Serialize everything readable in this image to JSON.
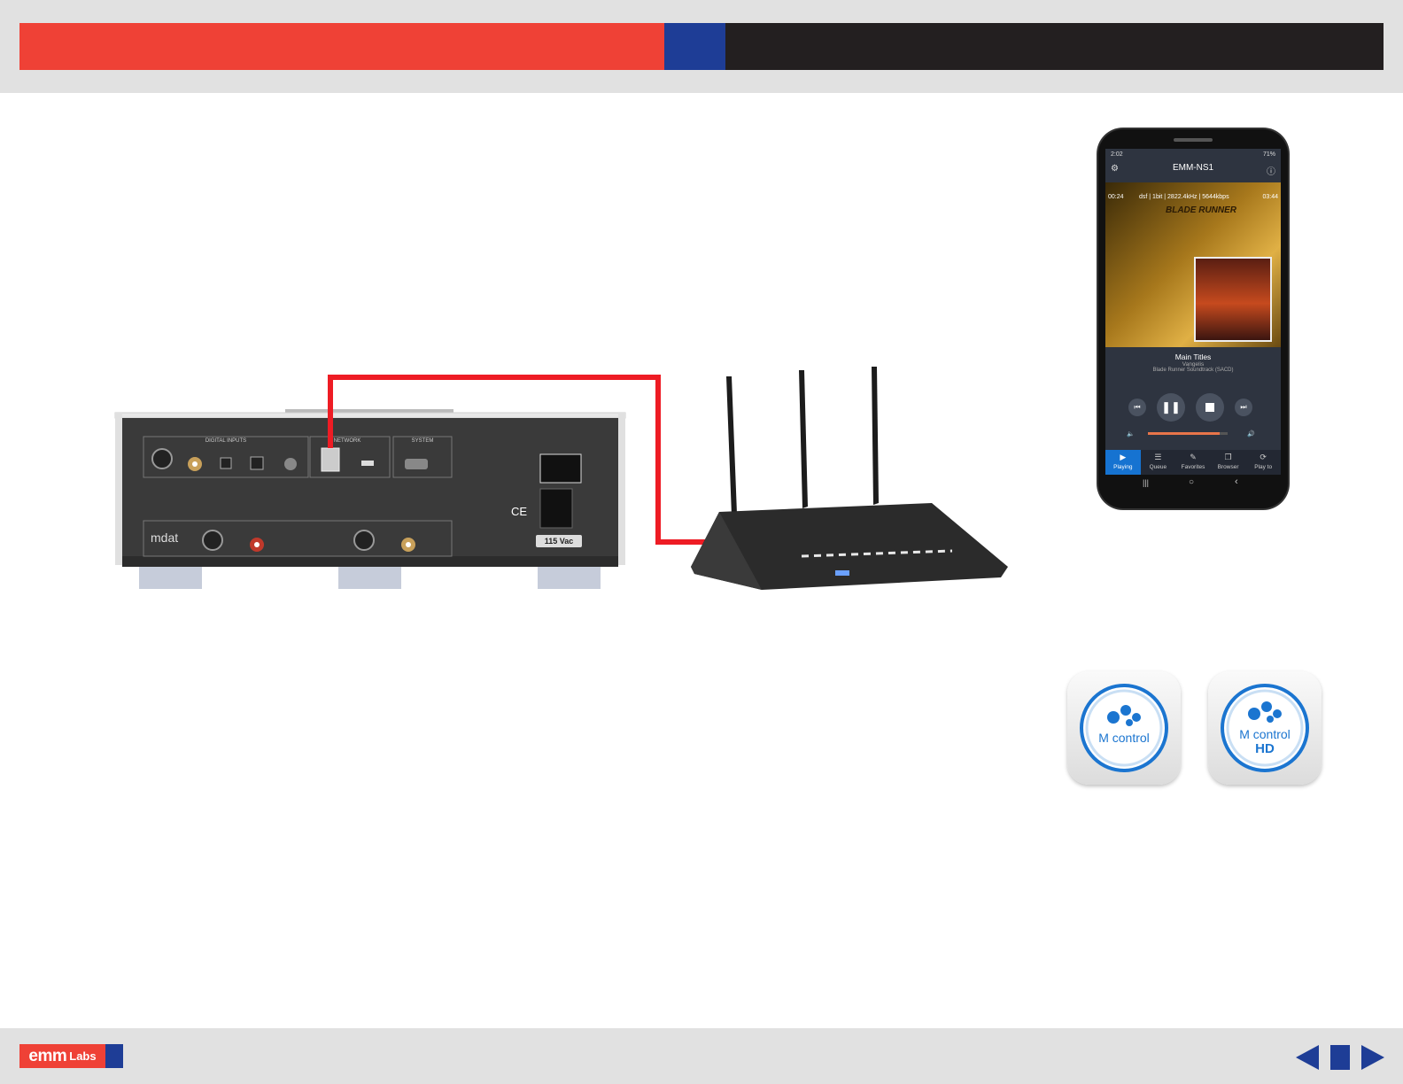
{
  "header": {
    "colors": {
      "red": "#ef4136",
      "blue": "#1e3d96",
      "black": "#231f20",
      "band": "#e1e1e1"
    }
  },
  "diagram": {
    "dac": {
      "brand_label": "mdat",
      "digital_inputs_label": "DIGITAL INPUTS",
      "network_label": "NETWORK",
      "system_label": "SYSTEM",
      "voltage_label": "115 Vac",
      "ce_mark": "CE"
    },
    "cable_color": "#ee1c24"
  },
  "phone": {
    "status_time": "2:02",
    "status_battery": "71%",
    "device_title": "EMM-NS1",
    "elapsed": "00:24",
    "format_line": "dsf | 1bit | 2822.4kHz | 5644kbps",
    "duration": "03:44",
    "album_art_text": "BLADE RUNNER",
    "track_title": "Main Titles",
    "artist": "Vangelis",
    "album": "Blade Runner Soundtrack (SACD)",
    "volume_level_percent": 90,
    "tabs": [
      {
        "label": "Playing",
        "icon": "play-icon",
        "active": true
      },
      {
        "label": "Queue",
        "icon": "queue-icon",
        "active": false
      },
      {
        "label": "Favorites",
        "icon": "favorites-icon",
        "active": false
      },
      {
        "label": "Browser",
        "icon": "browser-icon",
        "active": false
      },
      {
        "label": "Play to",
        "icon": "play-to-icon",
        "active": false
      }
    ]
  },
  "apps": [
    {
      "name": "M control",
      "suffix": ""
    },
    {
      "name": "M control",
      "suffix": "HD"
    }
  ],
  "footer": {
    "logo_main": "emm",
    "logo_sub": "Labs",
    "nav": [
      "previous-icon",
      "home-icon",
      "next-icon"
    ]
  }
}
